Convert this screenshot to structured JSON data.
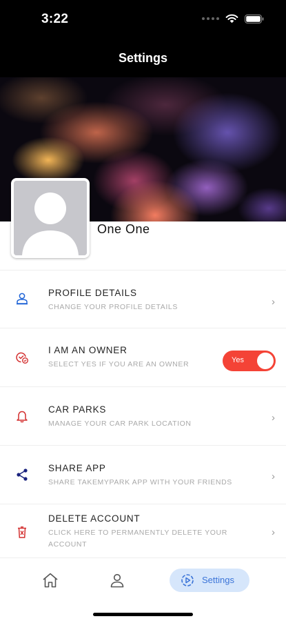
{
  "status_bar": {
    "time": "3:22"
  },
  "header": {
    "title": "Settings"
  },
  "profile": {
    "name": "One One"
  },
  "menu": {
    "items": [
      {
        "title": "PROFILE DETAILS",
        "subtitle": "CHANGE YOUR PROFILE DETAILS",
        "icon": "user-outline-icon",
        "icon_color": "#1e63d6"
      },
      {
        "title": "I AM AN OWNER",
        "subtitle": "SELECT YES IF YOU ARE AN OWNER",
        "icon": "owner-check-icon",
        "icon_color": "#d32f2f",
        "toggle_label": "Yes",
        "toggle_on": true,
        "toggle_color": "#f44336"
      },
      {
        "title": "CAR PARKS",
        "subtitle": "MANAGE YOUR CAR PARK LOCATION",
        "icon": "bell-icon",
        "icon_color": "#d32f2f"
      },
      {
        "title": "SHARE APP",
        "subtitle": "SHARE TAKEMYPARK APP WITH YOUR FRIENDS",
        "icon": "share-icon",
        "icon_color": "#1a237e"
      },
      {
        "title": "DELETE ACCOUNT",
        "subtitle": "CLICK HERE TO PERMANENTLY DELETE YOUR ACCOUNT",
        "icon": "trash-icon",
        "icon_color": "#d32f2f"
      }
    ]
  },
  "tab_bar": {
    "tabs": [
      {
        "name": "home",
        "icon": "home-icon",
        "active": false
      },
      {
        "name": "profile",
        "icon": "person-icon",
        "active": false
      },
      {
        "name": "settings",
        "icon": "settings-play-icon",
        "label": "Settings",
        "active": true
      }
    ],
    "active_color": "#3b74d8",
    "active_bg": "#d6e6fb"
  }
}
